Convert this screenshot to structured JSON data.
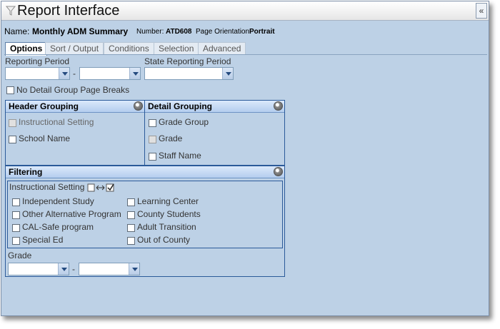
{
  "window": {
    "title": "Report Interface",
    "collapse_glyph": "«",
    "filter_icon": "funnel-icon"
  },
  "report": {
    "name_label": "Name:",
    "name_value": "Monthly ADM Summary",
    "number_label": "Number:",
    "number_value": "ATD608",
    "orientation_label": "Page Orientation:",
    "orientation_value": "Portrait"
  },
  "tabs": [
    {
      "label": "Options",
      "active": true
    },
    {
      "label": "Sort / Output",
      "active": false
    },
    {
      "label": "Conditions",
      "active": false
    },
    {
      "label": "Selection",
      "active": false
    },
    {
      "label": "Advanced",
      "active": false
    }
  ],
  "options": {
    "reporting_period_label": "Reporting Period",
    "state_reporting_period_label": "State Reporting Period",
    "period_start_value": "",
    "period_end_value": "",
    "state_period_value": "",
    "range_separator": "-",
    "no_detail_breaks_label": "No Detail Group Page Breaks"
  },
  "header_grouping": {
    "title": "Header Grouping",
    "items": [
      {
        "label": "Instructional Setting",
        "disabled": true
      },
      {
        "label": "School Name",
        "disabled": false
      }
    ]
  },
  "detail_grouping": {
    "title": "Detail Grouping",
    "items": [
      {
        "label": "Grade Group",
        "disabled": false
      },
      {
        "label": "Grade",
        "disabled": true
      },
      {
        "label": "Staff Name",
        "disabled": false
      }
    ]
  },
  "filtering": {
    "title": "Filtering",
    "instructional_setting_label": "Instructional Setting",
    "left_items": [
      "Independent Study",
      "Other Alternative Program",
      "CAL-Safe program",
      "Special Ed"
    ],
    "right_items": [
      "Learning Center",
      "County Students",
      "Adult Transition",
      "Out of County"
    ],
    "grade_label": "Grade",
    "grade_start_value": "",
    "grade_end_value": "",
    "range_separator": "-"
  },
  "colors": {
    "background": "#bdd1e6",
    "panel_border": "#2b5a99",
    "panel_header": "#b4cdee"
  }
}
